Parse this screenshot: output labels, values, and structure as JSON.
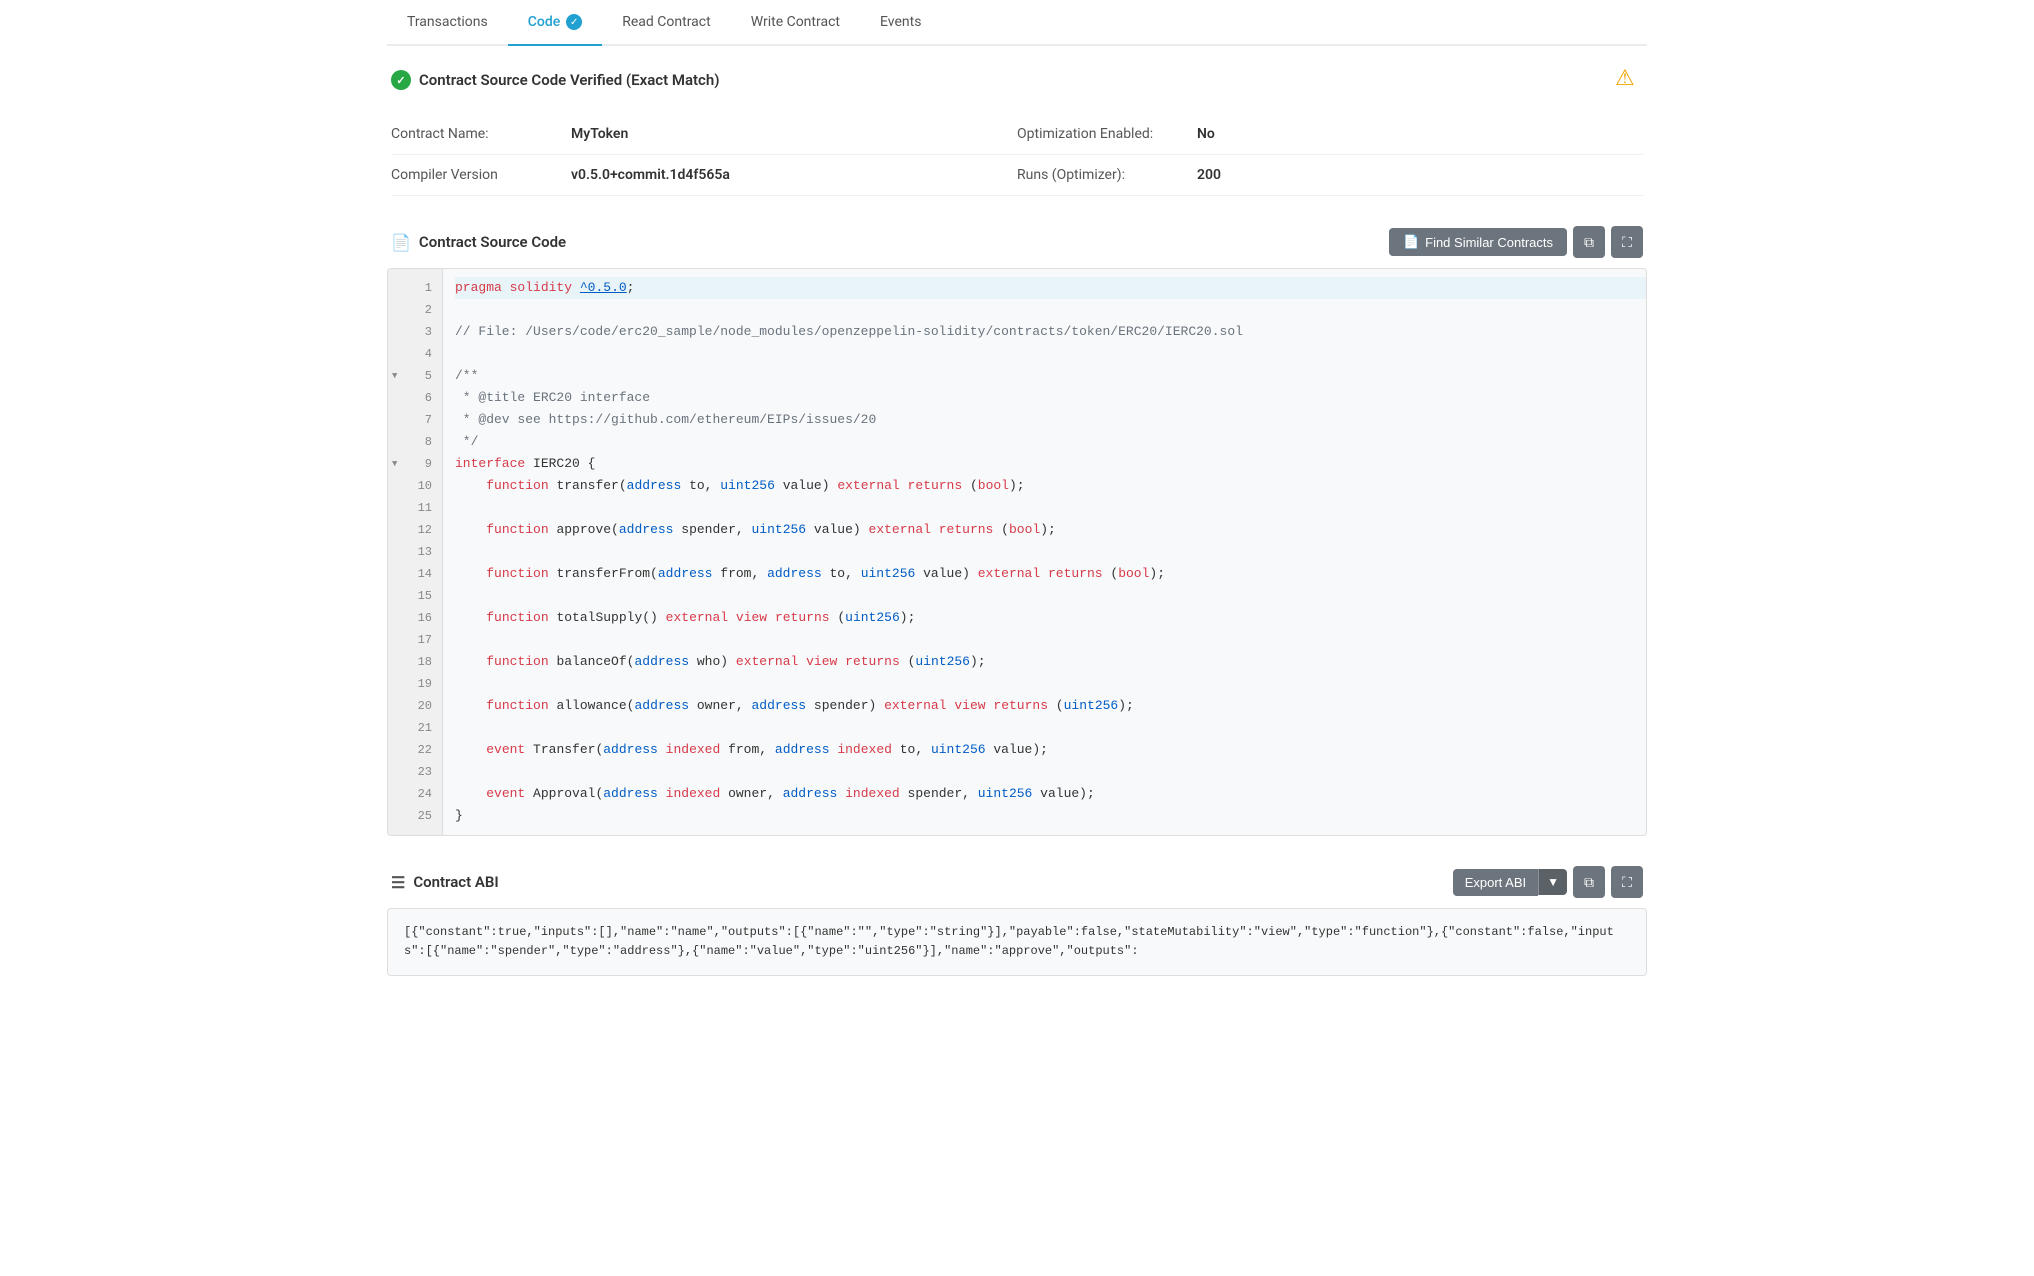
{
  "tabs": [
    {
      "id": "transactions",
      "label": "Transactions",
      "active": false,
      "verified": false
    },
    {
      "id": "code",
      "label": "Code",
      "active": true,
      "verified": true
    },
    {
      "id": "read-contract",
      "label": "Read Contract",
      "active": false,
      "verified": false
    },
    {
      "id": "write-contract",
      "label": "Write Contract",
      "active": false,
      "verified": false
    },
    {
      "id": "events",
      "label": "Events",
      "active": false,
      "verified": false
    }
  ],
  "verified_banner": {
    "text": "Contract Source Code Verified (Exact Match)",
    "icon": "✓",
    "warning_icon": "⚠"
  },
  "meta": {
    "contract_name_label": "Contract Name:",
    "contract_name_value": "MyToken",
    "optimization_label": "Optimization Enabled:",
    "optimization_value": "No",
    "compiler_label": "Compiler Version",
    "compiler_value": "v0.5.0+commit.1d4f565a",
    "runs_label": "Runs (Optimizer):",
    "runs_value": "200"
  },
  "source_code_section": {
    "title": "Contract Source Code",
    "icon": "📄",
    "find_similar_button": "Find Similar Contracts",
    "copy_tooltip": "Copy",
    "fullscreen_tooltip": "Fullscreen"
  },
  "code_lines": [
    {
      "num": 1,
      "content": "pragma solidity ^0.5.0;",
      "highlight": true,
      "marker": false
    },
    {
      "num": 2,
      "content": "",
      "highlight": false,
      "marker": false
    },
    {
      "num": 3,
      "content": "// File: /Users/code/erc20_sample/node_modules/openzeppelin-solidity/contracts/token/ERC20/IERC20.sol",
      "highlight": false,
      "marker": false
    },
    {
      "num": 4,
      "content": "",
      "highlight": false,
      "marker": false
    },
    {
      "num": 5,
      "content": "/**",
      "highlight": false,
      "marker": true
    },
    {
      "num": 6,
      "content": " * @title ERC20 interface",
      "highlight": false,
      "marker": false
    },
    {
      "num": 7,
      "content": " * @dev see https://github.com/ethereum/EIPs/issues/20",
      "highlight": false,
      "marker": false
    },
    {
      "num": 8,
      "content": " */",
      "highlight": false,
      "marker": false
    },
    {
      "num": 9,
      "content": "interface IERC20 {",
      "highlight": false,
      "marker": true
    },
    {
      "num": 10,
      "content": "    function transfer(address to, uint256 value) external returns (bool);",
      "highlight": false,
      "marker": false
    },
    {
      "num": 11,
      "content": "",
      "highlight": false,
      "marker": false
    },
    {
      "num": 12,
      "content": "    function approve(address spender, uint256 value) external returns (bool);",
      "highlight": false,
      "marker": false
    },
    {
      "num": 13,
      "content": "",
      "highlight": false,
      "marker": false
    },
    {
      "num": 14,
      "content": "    function transferFrom(address from, address to, uint256 value) external returns (bool);",
      "highlight": false,
      "marker": false
    },
    {
      "num": 15,
      "content": "",
      "highlight": false,
      "marker": false
    },
    {
      "num": 16,
      "content": "    function totalSupply() external view returns (uint256);",
      "highlight": false,
      "marker": false
    },
    {
      "num": 17,
      "content": "",
      "highlight": false,
      "marker": false
    },
    {
      "num": 18,
      "content": "    function balanceOf(address who) external view returns (uint256);",
      "highlight": false,
      "marker": false
    },
    {
      "num": 19,
      "content": "",
      "highlight": false,
      "marker": false
    },
    {
      "num": 20,
      "content": "    function allowance(address owner, address spender) external view returns (uint256);",
      "highlight": false,
      "marker": false
    },
    {
      "num": 21,
      "content": "",
      "highlight": false,
      "marker": false
    },
    {
      "num": 22,
      "content": "    event Transfer(address indexed from, address indexed to, uint256 value);",
      "highlight": false,
      "marker": false
    },
    {
      "num": 23,
      "content": "",
      "highlight": false,
      "marker": false
    },
    {
      "num": 24,
      "content": "    event Approval(address indexed owner, address indexed spender, uint256 value);",
      "highlight": false,
      "marker": false
    },
    {
      "num": 25,
      "content": "}",
      "highlight": false,
      "marker": false
    }
  ],
  "abi_section": {
    "title": "Contract ABI",
    "icon": "☰",
    "export_button": "Export ABI",
    "copy_tooltip": "Copy",
    "fullscreen_tooltip": "Fullscreen"
  },
  "abi_content": "[{\"constant\":true,\"inputs\":[],\"name\":\"name\",\"outputs\":[{\"name\":\"\",\"type\":\"string\"}],\"payable\":false,\"stateMutability\":\"view\",\"type\":\"function\"},{\"constant\":false,\"inputs\":[{\"name\":\"spender\",\"type\":\"address\"},{\"name\":\"value\",\"type\":\"uint256\"}],\"name\":\"approve\",\"outputs\":"
}
